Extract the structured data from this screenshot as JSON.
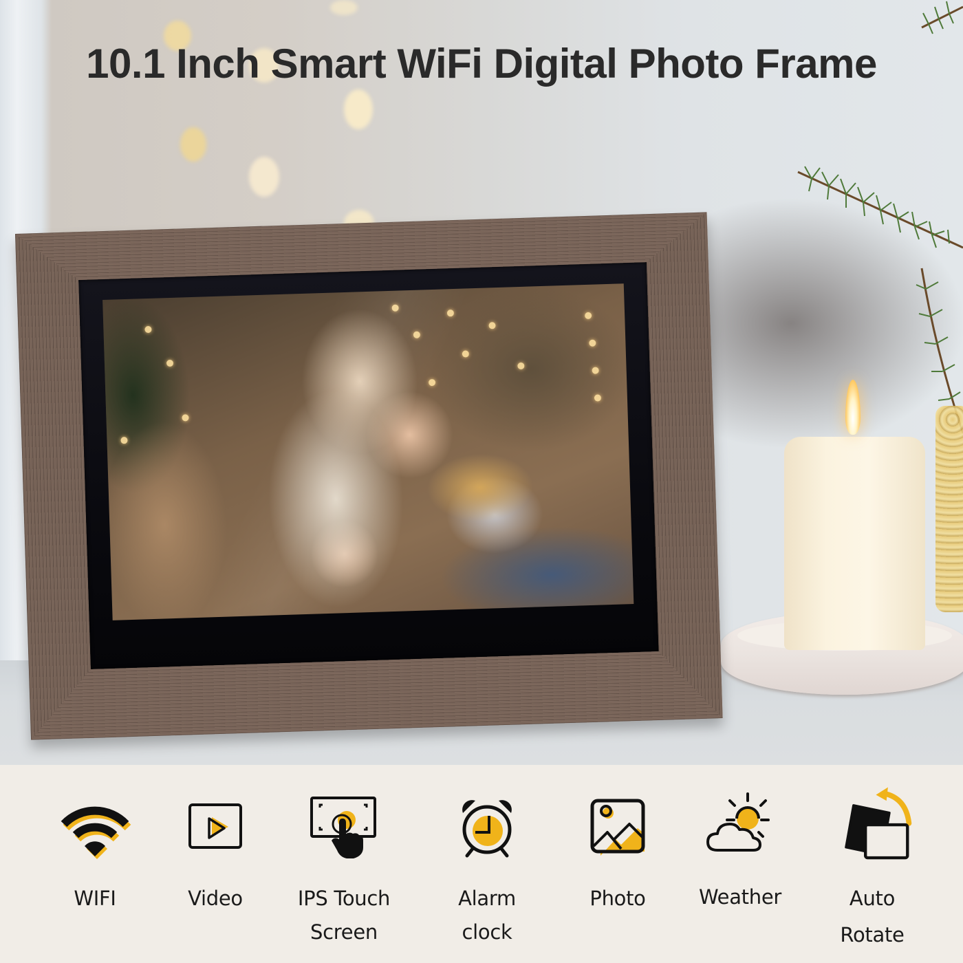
{
  "title": "10.1 Inch Smart WiFi Digital Photo Frame",
  "colors": {
    "accent": "#f0b31a",
    "icon_stroke": "#111111",
    "title_text": "#2a2a2a",
    "strip_bg": "#f1ede7",
    "frame_wood": "#7e6a5f"
  },
  "scene": {
    "product": "wood-grain digital photo frame",
    "screen_content": "family photo: mother with two children by a Christmas tree",
    "decor": [
      "lit pillar candle on white dish",
      "pine branches",
      "gold glass vase",
      "bokeh lights"
    ]
  },
  "features": [
    {
      "icon": "wifi-icon",
      "label_lines": [
        "WIFI"
      ]
    },
    {
      "icon": "video-play-icon",
      "label_lines": [
        "Video"
      ]
    },
    {
      "icon": "touch-screen-icon",
      "label_lines": [
        "IPS Touch",
        "Screen"
      ]
    },
    {
      "icon": "alarm-clock-icon",
      "label_lines": [
        "Alarm",
        "clock"
      ]
    },
    {
      "icon": "photo-icon",
      "label_lines": [
        "Photo"
      ]
    },
    {
      "icon": "weather-icon",
      "label_lines": [
        "Weather"
      ]
    },
    {
      "icon": "auto-rotate-icon",
      "label_lines": [
        "Auto",
        "Rotate"
      ]
    }
  ]
}
